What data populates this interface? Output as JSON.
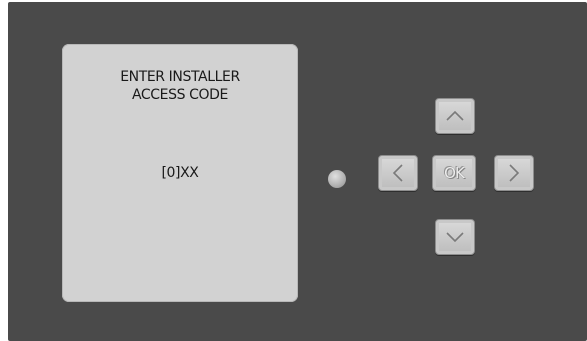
{
  "display": {
    "line1": "ENTER INSTALLER",
    "line2": "ACCESS CODE",
    "code": "[0]XX"
  },
  "keypad": {
    "ok_label": "OK",
    "up_icon": "chevron-up-icon",
    "down_icon": "chevron-down-icon",
    "left_icon": "chevron-left-icon",
    "right_icon": "chevron-right-icon"
  },
  "colors": {
    "panel": "#4a4a4a",
    "screen": "#d2d2d2",
    "key": "#c8c8c8"
  }
}
